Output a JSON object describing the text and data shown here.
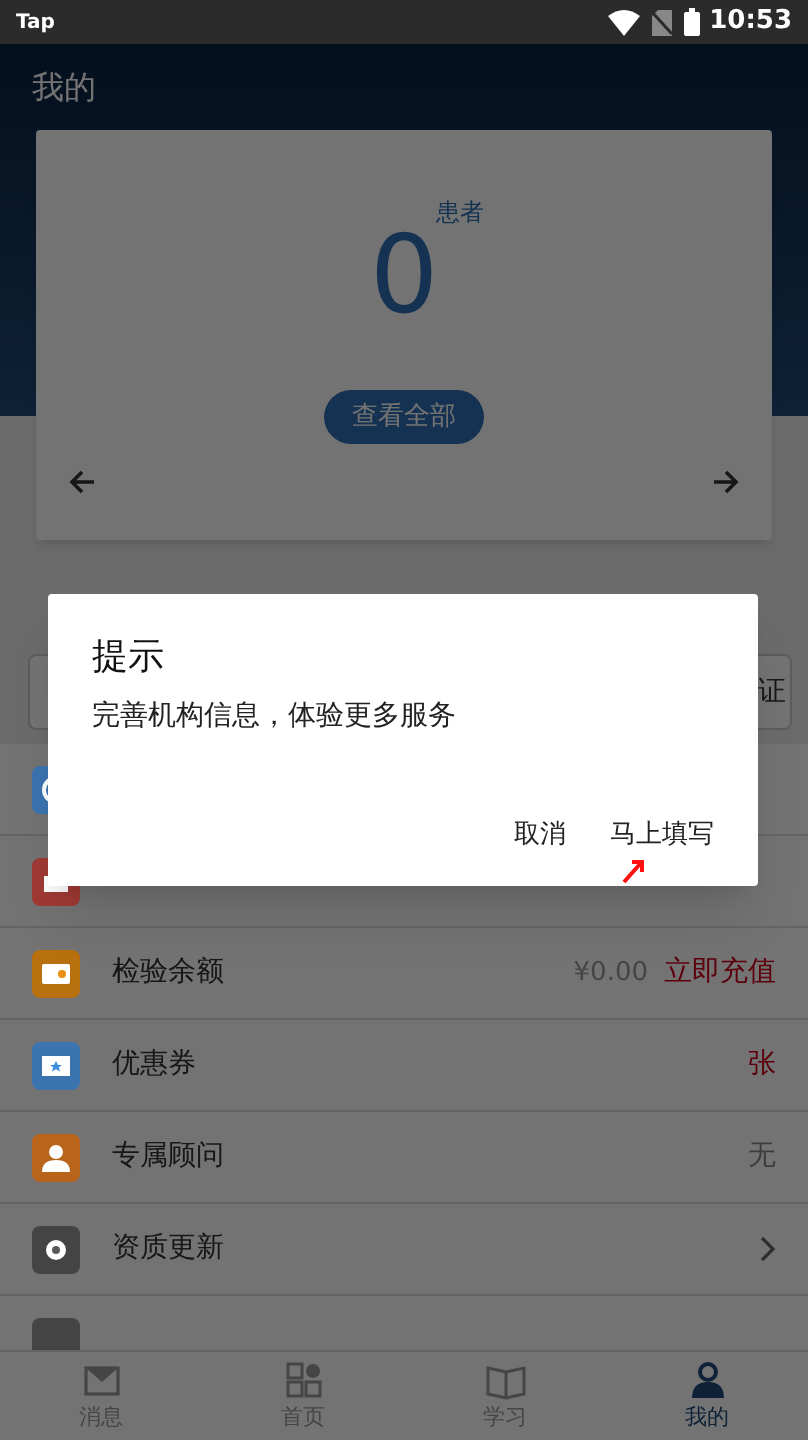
{
  "status_bar": {
    "app_label": "Tap",
    "time": "10:53"
  },
  "header": {
    "title": "我的"
  },
  "summary_card": {
    "count": "0",
    "count_label": "患者",
    "view_all": "查看全部"
  },
  "field_row": {
    "suffix": "证"
  },
  "menu": [
    {
      "kind": "covered",
      "color": "#3c74b0"
    },
    {
      "kind": "covered",
      "color": "#a03a35"
    },
    {
      "kind": "balance",
      "color": "#b8700f",
      "label": "检验余额",
      "amount": "¥0.00",
      "action": "立即充值"
    },
    {
      "kind": "value",
      "color": "#3c74b0",
      "label": "优惠券",
      "value": "张",
      "alert": true
    },
    {
      "kind": "value",
      "color": "#b8641a",
      "label": "专属顾问",
      "value": "无",
      "alert": false
    },
    {
      "kind": "link",
      "color": "#444444",
      "label": "资质更新"
    },
    {
      "kind": "covered",
      "color": "#444444"
    }
  ],
  "tabs": [
    {
      "label": "消息",
      "selected": false
    },
    {
      "label": "首页",
      "selected": false
    },
    {
      "label": "学习",
      "selected": false
    },
    {
      "label": "我的",
      "selected": true
    }
  ],
  "dialog": {
    "title": "提示",
    "message": "完善机构信息，体验更多服务",
    "buttons": [
      "取消",
      "马上填写"
    ]
  }
}
